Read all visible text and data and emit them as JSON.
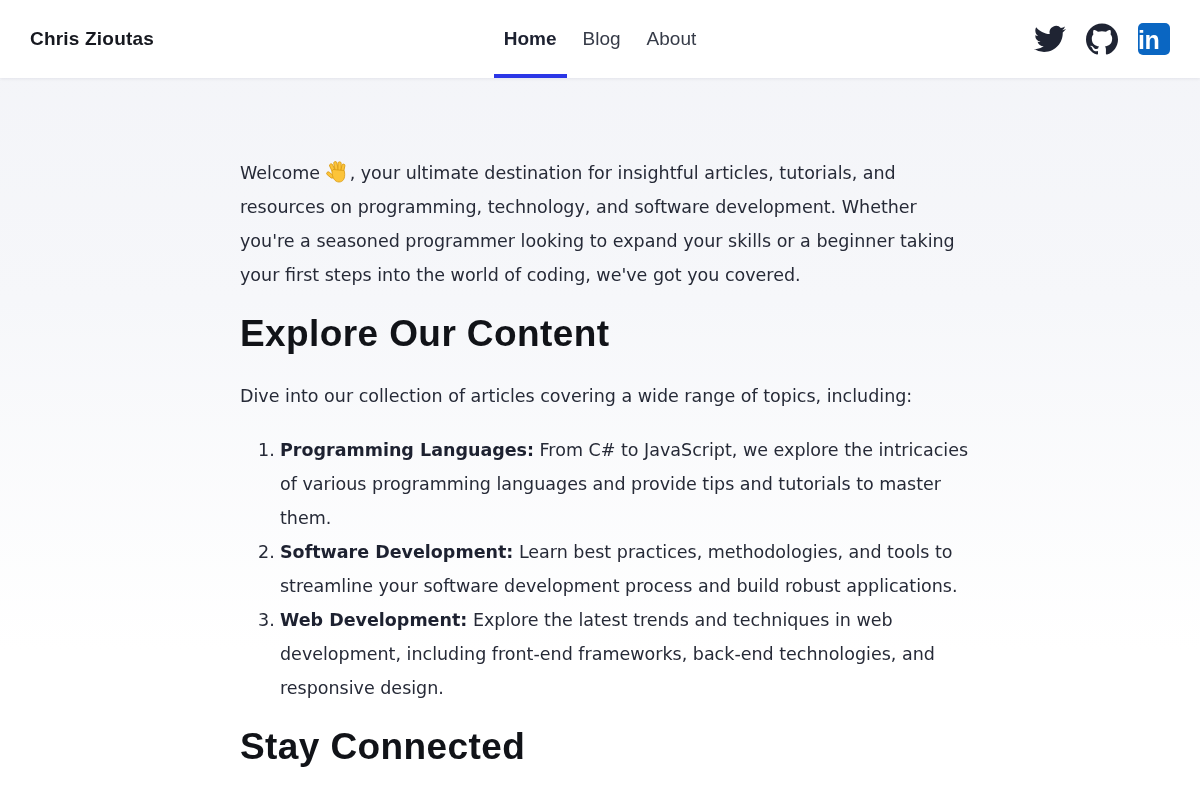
{
  "header": {
    "brand": "Chris Zioutas",
    "nav": [
      {
        "label": "Home",
        "selected": true
      },
      {
        "label": "Blog",
        "selected": false
      },
      {
        "label": "About",
        "selected": false
      }
    ],
    "social_links": [
      {
        "kind": "bird"
      },
      {
        "kind": "cat"
      },
      {
        "kind": "tile",
        "text": "in"
      }
    ]
  },
  "intro": {
    "before_icon": "Welcome",
    "after_icon": ", your ultimate destination for insightful articles, tutorials, and resources on programming, technology, and software development. Whether you're a seasoned programmer looking to expand your skills or a beginner taking your first steps into the world of coding, we've got you covered."
  },
  "sections": [
    {
      "heading": "Explore Our Content",
      "text": "Dive into our collection of articles covering a wide range of topics, including:",
      "list": [
        {
          "number": "1.",
          "text": "**Programming Languages:** From C# to JavaScript, we explore the intricacies of various programming languages and provide tips and tutorials to master them."
        },
        {
          "number": "2.",
          "text": "**Software Development:** Learn best practices, methodologies, and tools to streamline your software development process and build robust applications."
        },
        {
          "number": "3.",
          "text": "**Web Development:** Explore the latest trends and techniques in web development, including front-end frameworks, back-end technologies, and responsive design."
        }
      ]
    },
    {
      "heading": "Stay Connected"
    }
  ]
}
